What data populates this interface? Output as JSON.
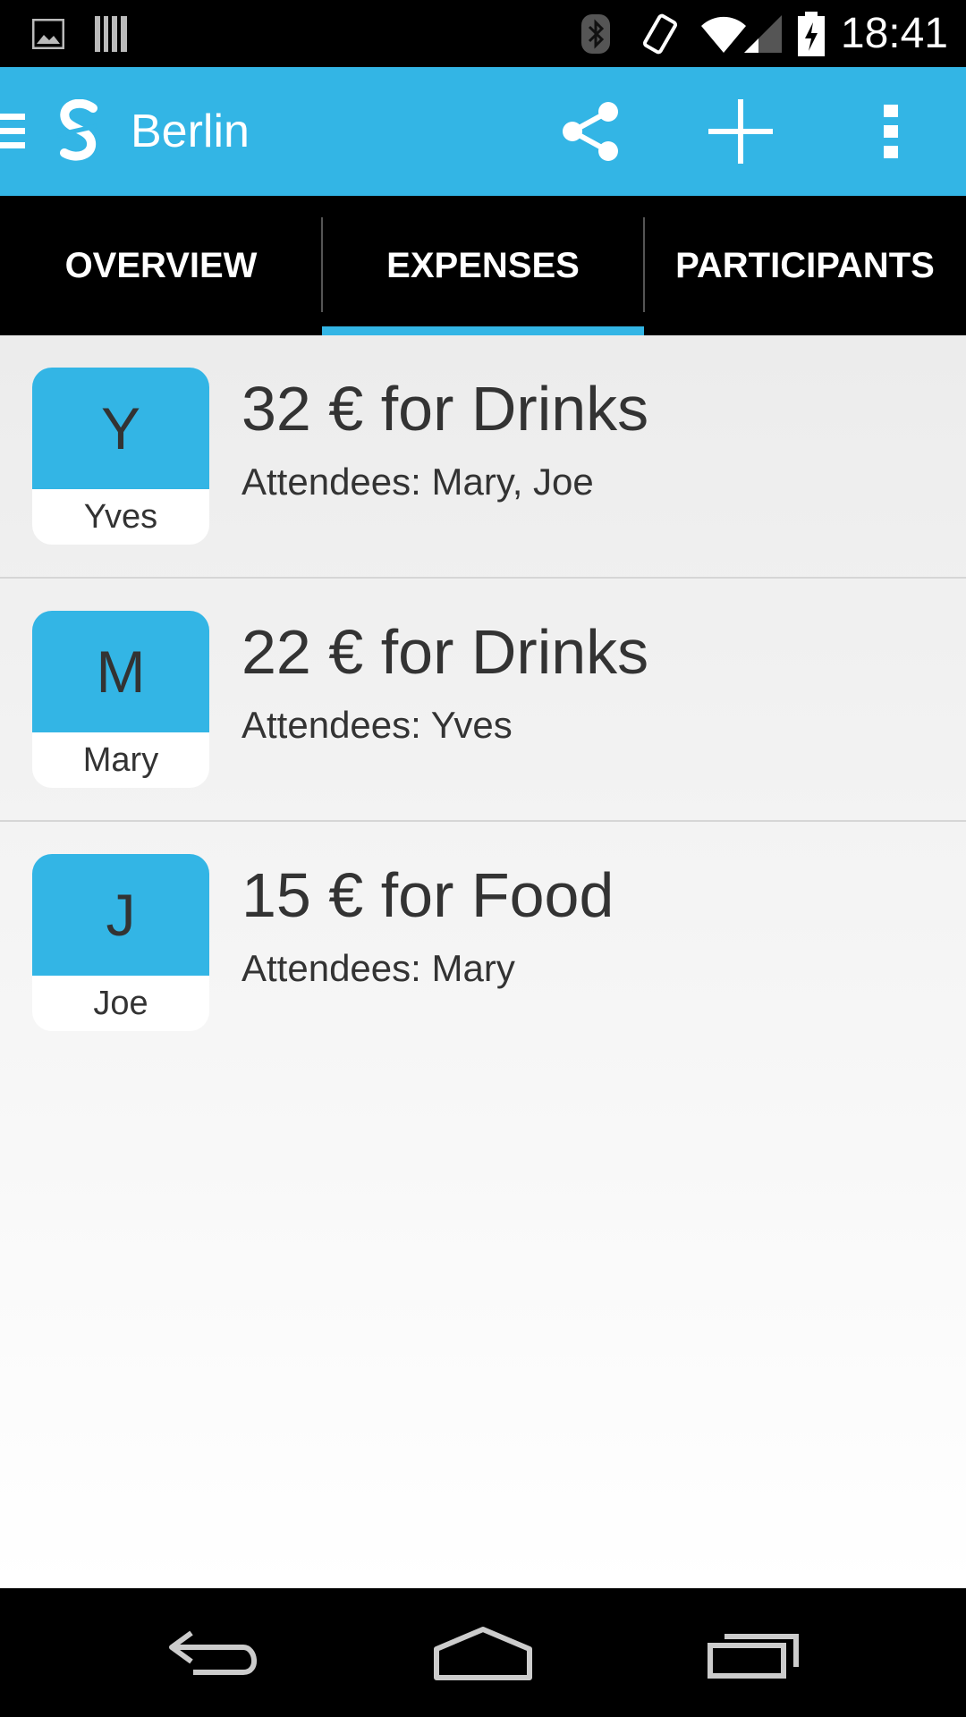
{
  "status_bar": {
    "time": "18:41",
    "icons": [
      "image-icon",
      "barcode-icon",
      "bluetooth-icon",
      "vibrate-icon",
      "wifi-icon",
      "signal-icon",
      "battery-charging-icon"
    ]
  },
  "app_bar": {
    "title": "Berlin",
    "actions": [
      "share-icon",
      "add-icon",
      "overflow-menu-icon"
    ],
    "color": "#33b5e5"
  },
  "tabs": [
    {
      "label": "OVERVIEW",
      "selected": false
    },
    {
      "label": "EXPENSES",
      "selected": true
    },
    {
      "label": "PARTICIPANTS",
      "selected": false
    }
  ],
  "expenses": [
    {
      "initial": "Y",
      "payer": "Yves",
      "title": "32 € for Drinks",
      "attendees": "Attendees: Mary, Joe"
    },
    {
      "initial": "M",
      "payer": "Mary",
      "title": "22 € for Drinks",
      "attendees": "Attendees: Yves"
    },
    {
      "initial": "J",
      "payer": "Joe",
      "title": "15 € for Food",
      "attendees": "Attendees: Mary"
    }
  ],
  "nav_bar": {
    "buttons": [
      "back-icon",
      "home-icon",
      "recent-apps-icon"
    ]
  }
}
